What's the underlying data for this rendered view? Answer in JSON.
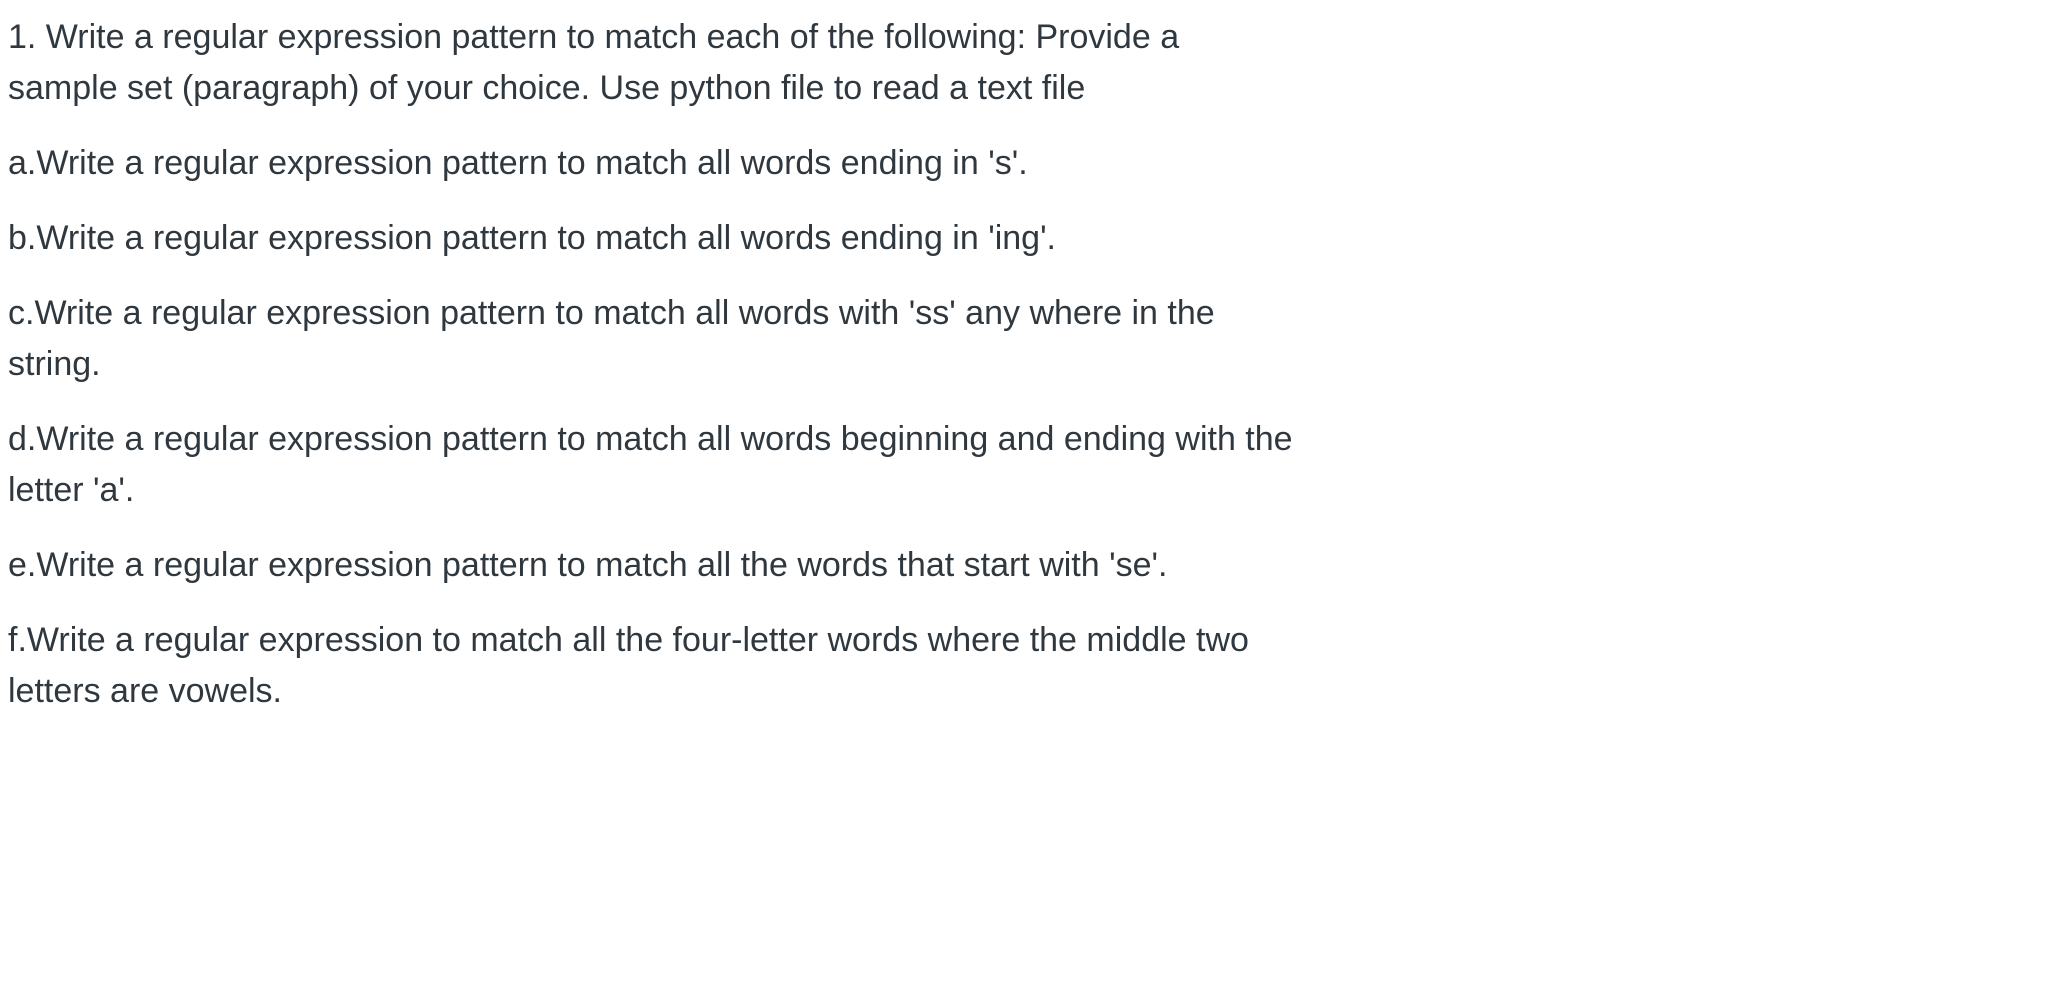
{
  "question": {
    "number_line1": "1.  Write a regular expression pattern to match each of the following: Provide a",
    "number_line2": "sample set (paragraph) of your choice. Use python file to read a text file",
    "items": {
      "a": "a.Write a regular expression pattern to match all words ending in 's'.",
      "b": "b.Write a regular expression pattern to match all words ending in 'ing'.",
      "c_line1": "c.Write a regular expression pattern to match all words with 'ss' any where in the",
      "c_line2": "string.",
      "d_line1": "d.Write a regular expression pattern to match all words beginning and ending with the",
      "d_line2": "letter 'a'.",
      "e": "e.Write a regular expression pattern to match all the words that start with 'se'.",
      "f_line1": "f.Write a regular expression to match all the four-letter words where the middle two",
      "f_line2": "letters are vowels."
    }
  }
}
